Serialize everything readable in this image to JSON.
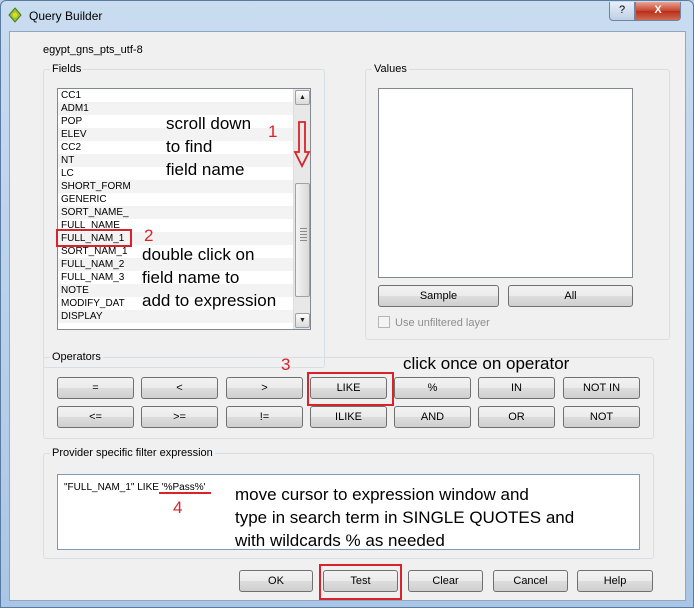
{
  "window": {
    "title": "Query Builder",
    "help_glyph": "?",
    "close_glyph": "X"
  },
  "layer_name": "egypt_gns_pts_utf-8",
  "fields": {
    "legend": "Fields",
    "items": [
      "CC1",
      "ADM1",
      "POP",
      "ELEV",
      "CC2",
      "NT",
      "LC",
      "SHORT_FORM",
      "GENERIC",
      "SORT_NAME_",
      "FULL_NAME_",
      "FULL_NAM_1",
      "SORT_NAM_1",
      "FULL_NAM_2",
      "FULL_NAM_3",
      "NOTE",
      "MODIFY_DAT",
      "DISPLAY"
    ]
  },
  "values": {
    "legend": "Values",
    "sample_label": "Sample",
    "all_label": "All",
    "unfiltered_label": "Use unfiltered layer"
  },
  "operators": {
    "legend": "Operators",
    "row1": [
      "=",
      "<",
      ">",
      "LIKE",
      "%",
      "IN",
      "NOT IN"
    ],
    "row2": [
      "<=",
      ">=",
      "!=",
      "ILIKE",
      "AND",
      "OR",
      "NOT"
    ]
  },
  "filter": {
    "legend": "Provider specific filter expression",
    "expression": "\"FULL_NAM_1\" LIKE '%Pass%'"
  },
  "buttons": {
    "ok": "OK",
    "test": "Test",
    "clear": "Clear",
    "cancel": "Cancel",
    "help": "Help"
  },
  "annotations": {
    "n1": "1",
    "n2": "2",
    "n3": "3",
    "n4": "4",
    "step1": [
      "scroll down",
      "to find",
      "field name"
    ],
    "step2": [
      "double click on",
      "field name to",
      "add to expression"
    ],
    "step3": "click once on operator",
    "step4": [
      "move cursor to expression window and",
      "type in search term in SINGLE QUOTES and",
      "with wildcards % as needed"
    ],
    "color": "#d8232a"
  }
}
